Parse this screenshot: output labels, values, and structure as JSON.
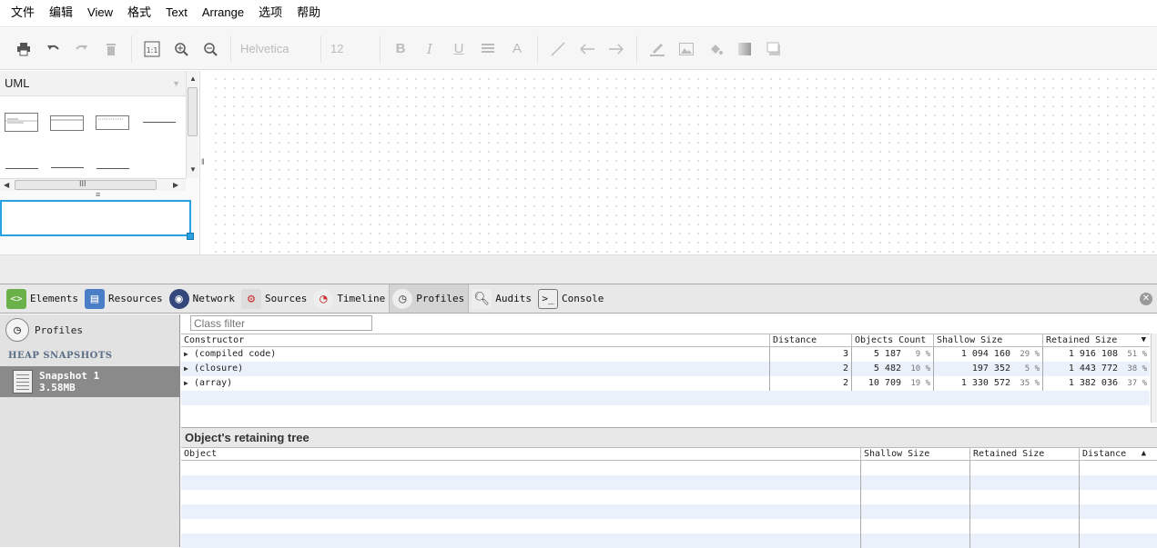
{
  "menu": [
    "文件",
    "编辑",
    "View",
    "格式",
    "Text",
    "Arrange",
    "选项",
    "帮助"
  ],
  "toolbar": {
    "font": "Helvetica",
    "size": "12",
    "icons": [
      "print-icon",
      "undo-icon",
      "redo-icon",
      "delete-icon",
      "actual-size-icon",
      "zoom-in-icon",
      "zoom-out-icon",
      "bold-icon",
      "italic-icon",
      "underline-icon",
      "align-icon",
      "font-color-icon",
      "line-icon",
      "arrow-left-icon",
      "arrow-right-icon",
      "line-color-icon",
      "image-icon",
      "fill-icon",
      "gradient-icon",
      "shadow-icon"
    ]
  },
  "shapes_panel": {
    "title": "UML",
    "scroll_h_label": "III",
    "grip": "≡"
  },
  "devtools": {
    "tabs": [
      {
        "label": "Elements",
        "icon": "elements-icon"
      },
      {
        "label": "Resources",
        "icon": "resources-icon"
      },
      {
        "label": "Network",
        "icon": "network-icon"
      },
      {
        "label": "Sources",
        "icon": "sources-icon"
      },
      {
        "label": "Timeline",
        "icon": "timeline-icon"
      },
      {
        "label": "Profiles",
        "icon": "profiles-icon",
        "selected": true
      },
      {
        "label": "Audits",
        "icon": "audits-icon"
      },
      {
        "label": "Console",
        "icon": "console-icon"
      }
    ],
    "sidebar": {
      "profiles_label": "Profiles",
      "section": "HEAP SNAPSHOTS",
      "snapshot_name": "Snapshot 1",
      "snapshot_size": "3.58MB"
    },
    "filter_placeholder": "Class filter",
    "columns": [
      "Constructor",
      "Distance",
      "Objects Count",
      "Shallow Size",
      "Retained Size"
    ],
    "rows": [
      {
        "name": "(compiled code)",
        "distance": "3",
        "count": "5 187",
        "count_pct": "9 %",
        "shallow": "1 094 160",
        "shallow_pct": "29 %",
        "retained": "1 916 108",
        "retained_pct": "51 %"
      },
      {
        "name": "(closure)",
        "distance": "2",
        "count": "5 482",
        "count_pct": "10 %",
        "shallow": "197 352",
        "shallow_pct": "5 %",
        "retained": "1 443 772",
        "retained_pct": "38 %"
      },
      {
        "name": "(array)",
        "distance": "2",
        "count": "10 709",
        "count_pct": "19 %",
        "shallow": "1 330 572",
        "shallow_pct": "35 %",
        "retained": "1 382 036",
        "retained_pct": "37 %"
      }
    ],
    "retaining_title": "Object's retaining tree",
    "retaining_columns": [
      "Object",
      "Shallow Size",
      "Retained Size",
      "Distance"
    ]
  }
}
